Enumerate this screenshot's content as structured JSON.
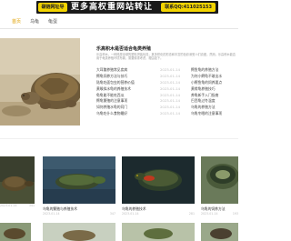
{
  "banner": {
    "logo": "碳链网址导",
    "headline": "更多高权重网站转让",
    "qq": "联系QQ:411025153"
  },
  "nav": {
    "items": [
      {
        "label": "首页",
        "active": true
      },
      {
        "label": "乌龟",
        "active": false
      },
      {
        "label": "龟蛋",
        "active": false
      }
    ]
  },
  "main": {
    "title": "乐高积木是否适合龟类养殖",
    "description": "乐高积木，一种风靡全球的塑料拼装玩具，其多样化的形态和丰富的色彩深受人们喜爱。然而，乐高积木能否用于龟类养殖环境布置，需要慎重考虑，理由如下。",
    "list": [
      {
        "left": "大耳鳖养殖常见疾病",
        "date": "2023-01-14",
        "right": "鳄鱼龟的养殖方法"
      },
      {
        "left": "鳄龟饲养方法与技巧",
        "date": "2023-01-14",
        "right": "为何小鳄龟不敢出水"
      },
      {
        "left": "陆龟吃面包虫的营养价值",
        "date": "2023-01-14",
        "right": "小鳄鱼龟的饲养要点"
      },
      {
        "left": "黄喉拟水龟的养殖技术",
        "date": "2023-01-14",
        "right": "黄缘龟养殖技巧"
      },
      {
        "left": "龟龟能不能吃西瓜",
        "date": "2023-01-14",
        "right": "养龟新手入门指南"
      },
      {
        "left": "鳄龟繁殖的注意事项",
        "date": "2023-01-14",
        "right": "巴西龟过冬温度"
      },
      {
        "left": "如何养殖水龟的窍门",
        "date": "2023-01-14",
        "right": "乌龟的养殖方法"
      },
      {
        "left": "乌龟吃什么食物最好",
        "date": "2023-01-14",
        "right": "乌龟冬眠的注意事项"
      }
    ]
  },
  "cards": [
    {
      "title": "",
      "date": "2023-01-14",
      "views": "341"
    },
    {
      "title": "乌龟的繁殖与养殖技术",
      "date": "2023-01-14",
      "views": "347"
    },
    {
      "title": "乌龟的养殖技术",
      "date": "2023-01-14",
      "views": "281"
    },
    {
      "title": "乌龟的饲养方法",
      "date": "2023-01-14",
      "views": "193"
    },
    {
      "title": "鳄龟的饲养方法",
      "date": "2023-01-14",
      "views": "190"
    }
  ],
  "colors": {
    "accent": "#e0a000",
    "banner_bg": "#1a1a1a",
    "banner_yellow": "#f3d400"
  }
}
